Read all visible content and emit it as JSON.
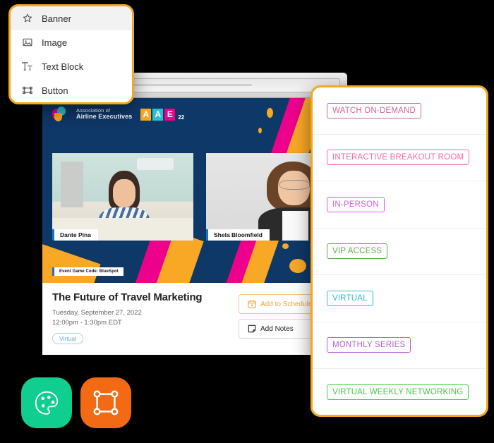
{
  "browser": {
    "back_label": "◀",
    "forward_label": "▶",
    "address_value": ""
  },
  "component_menu": {
    "items": [
      {
        "label": "Banner",
        "icon": "star-icon",
        "active": true
      },
      {
        "label": "Image",
        "icon": "image-icon",
        "active": false
      },
      {
        "label": "Text Block",
        "icon": "text-format-icon",
        "active": false
      },
      {
        "label": "Button",
        "icon": "button-frame-icon",
        "active": false
      }
    ]
  },
  "banner": {
    "association_line1": "Association of",
    "association_line2": "Airline Executives",
    "logo_letters": [
      "A",
      "A",
      "E"
    ],
    "logo_letter_colors": [
      "#f9a825",
      "#2bbfd4",
      "#ec008c"
    ],
    "logo_year": "22",
    "background_color": "#0e3868",
    "stripe_pink": "#ec008c",
    "stripe_orange": "#f9a825",
    "game_code": "Event Game Code: BlueSpot",
    "participants": [
      {
        "name": "Dante Pina"
      },
      {
        "name": "Shela Bloomfield"
      }
    ]
  },
  "event": {
    "title": "The Future of Travel Marketing",
    "date": "Tuesday, September 27, 2022",
    "time": "12:00pm - 1:30pm EDT",
    "chip": "Virtual",
    "actions": [
      {
        "label": "Add to Schedule",
        "icon": "calendar-add-icon",
        "color": "#f0a33c"
      },
      {
        "label": "Add Notes",
        "icon": "note-icon",
        "color": "#222222"
      }
    ]
  },
  "tag_panel": {
    "accent_color": "#f4a81d",
    "tags": [
      {
        "label": "WATCH ON-DEMAND",
        "color": "#cc6699"
      },
      {
        "label": "INTERACTIVE BREAKOUT ROOM",
        "color": "#ff66a8"
      },
      {
        "label": "IN-PERSON",
        "color": "#d660dd"
      },
      {
        "label": "VIP ACCESS",
        "color": "#5cab4a"
      },
      {
        "label": "VIRTUAL",
        "color": "#33b8c4"
      },
      {
        "label": "MONTHLY SERIES",
        "color": "#bb5ce0"
      },
      {
        "label": "VIRTUAL WEEKLY NETWORKING",
        "color": "#3fcc3f"
      }
    ]
  },
  "app_icons": [
    {
      "name": "palette-icon",
      "background": "#0fce8f"
    },
    {
      "name": "nodes-frame-icon",
      "background": "#f26a14"
    }
  ]
}
